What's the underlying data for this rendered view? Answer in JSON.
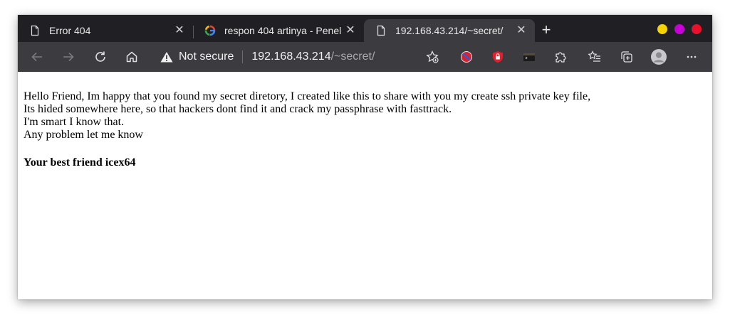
{
  "tabs": [
    {
      "title": "Error 404",
      "active": false
    },
    {
      "title": "respon 404 artinya - Penel",
      "active": false
    },
    {
      "title": "192.168.43.214/~secret/",
      "active": true
    }
  ],
  "window_dots": [
    "#f5d200",
    "#c800d8",
    "#e8102a"
  ],
  "addressbar": {
    "security_label": "Not secure",
    "url_host": "192.168.43.214",
    "url_path": "/~secret/"
  },
  "page": {
    "lines": [
      "Hello Friend, Im happy that you found my secret diretory, I created like this to share with you my create ssh private key file,",
      "Its hided somewhere here, so that hackers dont find it and crack my passphrase with fasttrack.",
      "I'm smart I know that.",
      "Any problem let me know"
    ],
    "signature": "Your best friend icex64"
  }
}
